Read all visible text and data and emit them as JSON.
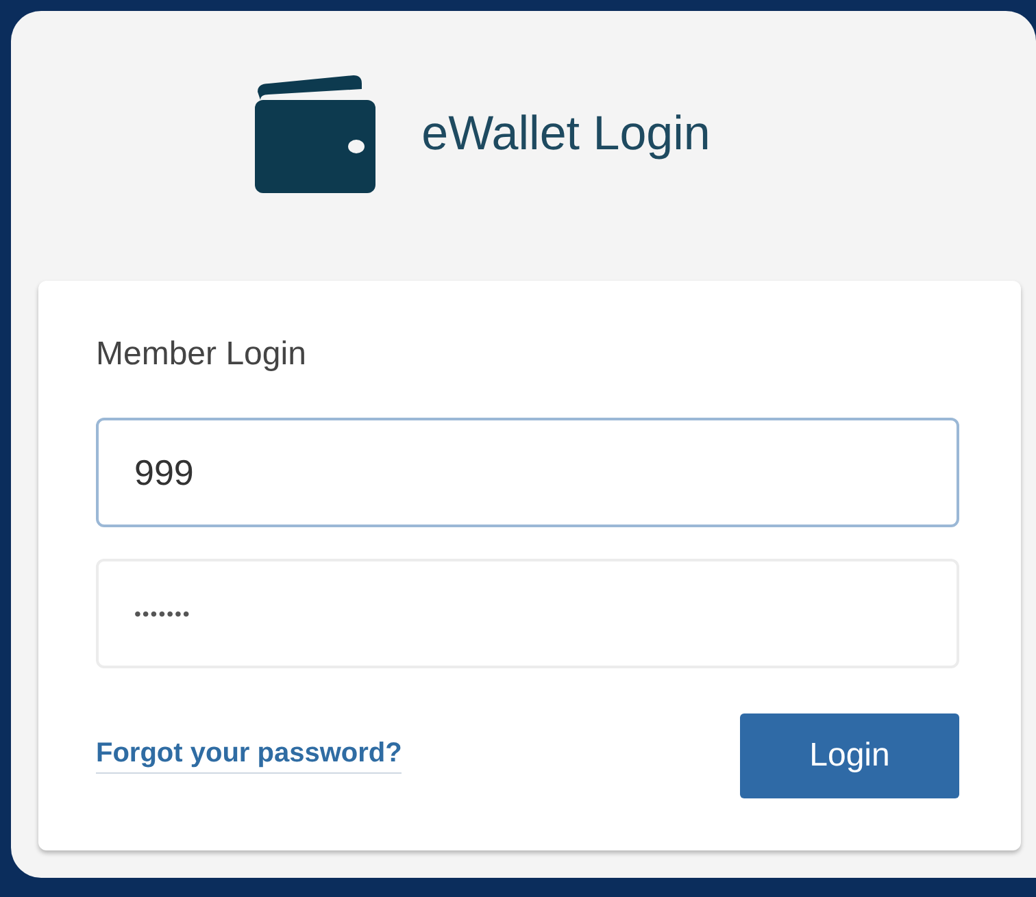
{
  "header": {
    "title": "eWallet Login"
  },
  "card": {
    "heading": "Member Login",
    "fields": [
      {
        "kind": "text",
        "value": "999",
        "focused": true
      },
      {
        "kind": "password",
        "value": "•••••••",
        "focused": false
      }
    ],
    "forgot_link": "Forgot your password?",
    "login_button": "Login"
  }
}
